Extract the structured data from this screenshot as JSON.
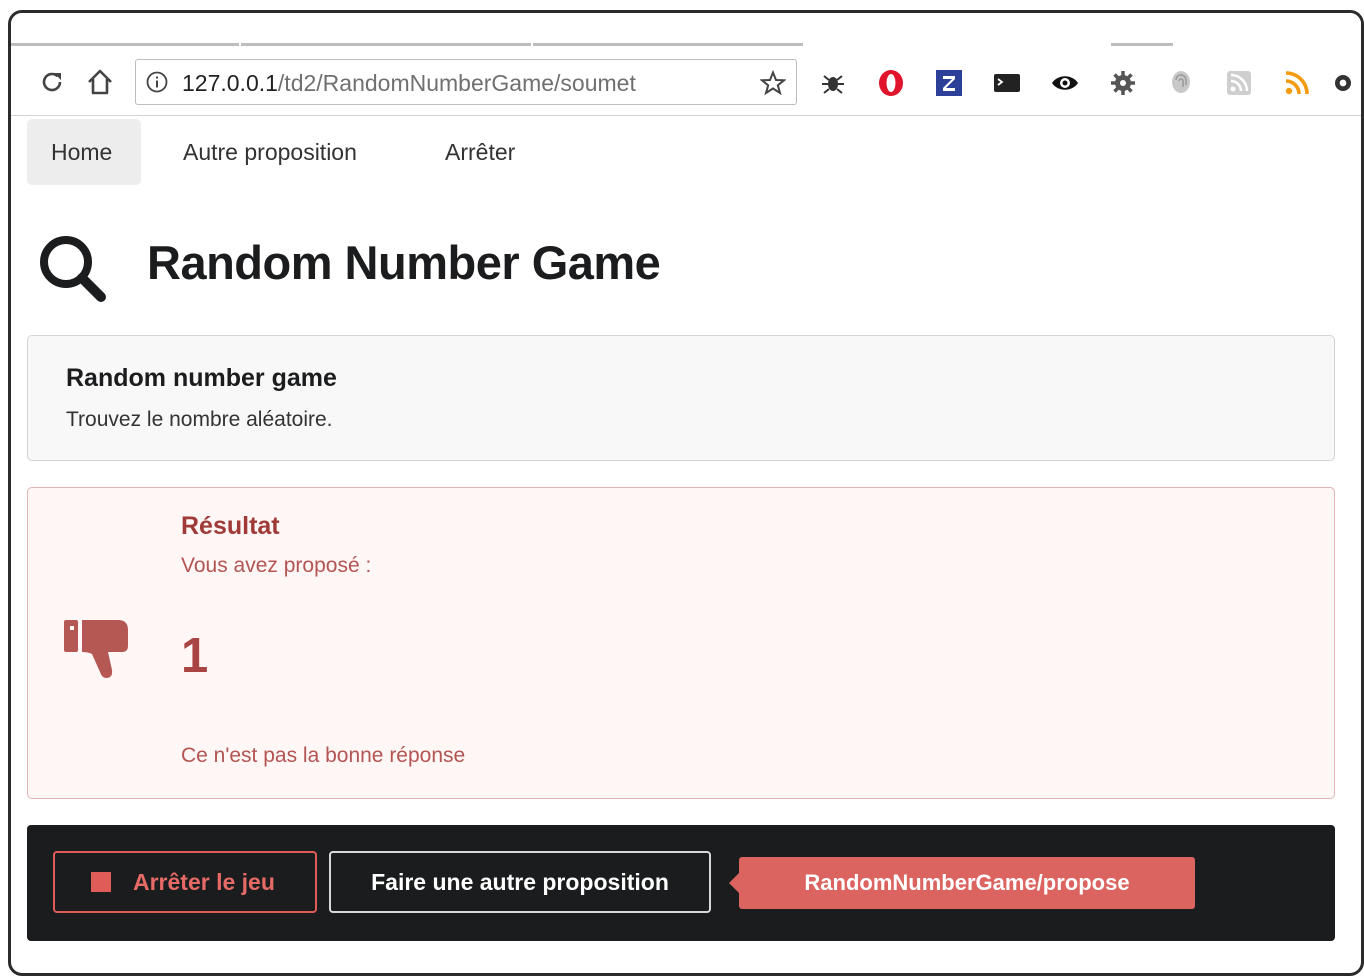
{
  "browser": {
    "url_host": "127.0.0.1",
    "url_path": "/td2/RandomNumberGame/soumet",
    "extensions": [
      "bug-icon",
      "opera-icon",
      "zotero-icon",
      "terminal-icon",
      "eye-icon",
      "gear-icon",
      "fingerprint-icon",
      "rss-gray-icon",
      "rss-icon",
      "chrome-icon"
    ]
  },
  "nav": {
    "items": [
      {
        "label": "Home",
        "active": true
      },
      {
        "label": "Autre proposition",
        "active": false
      },
      {
        "label": "Arrêter",
        "active": false
      }
    ]
  },
  "header": {
    "title": "Random Number Game",
    "icon": "search-icon"
  },
  "info_message": {
    "title": "Random number game",
    "text": "Trouvez le nombre aléatoire."
  },
  "result_message": {
    "icon": "thumbs-down-icon",
    "title": "Résultat",
    "subtitle": "Vous avez proposé :",
    "value": "1",
    "footer": "Ce n'est pas la bonne réponse"
  },
  "actions": {
    "stop_label": "Arrêter le jeu",
    "other_label": "Faire une autre proposition",
    "tag_label": "RandomNumberGame/propose"
  },
  "colors": {
    "error_text": "#9f3a38",
    "error_bg": "#fff6f6",
    "accent_red": "#db6460",
    "bar_bg": "#1b1c1d"
  }
}
